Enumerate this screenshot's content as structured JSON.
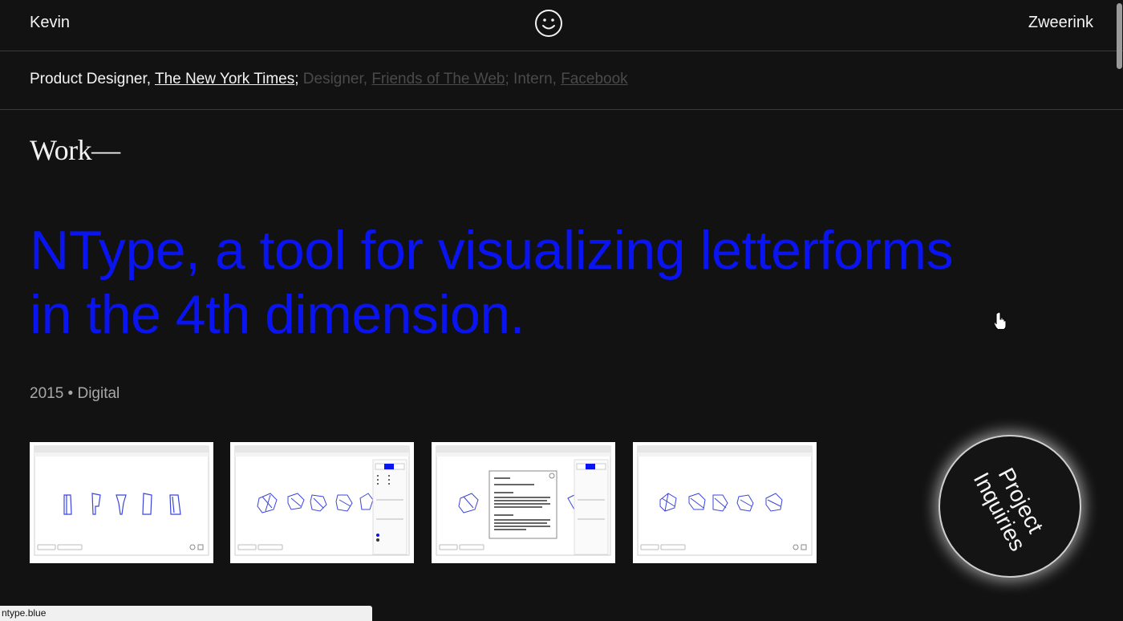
{
  "header": {
    "first_name": "Kevin",
    "last_name": "Zweerink",
    "logo_icon": "smiley-face-icon"
  },
  "roles": {
    "current_title": "Product Designer, ",
    "current_employer": "The New York Times",
    "current_sep": ";",
    "past_1_title": " Designer, ",
    "past_1_employer": "Friends of The Web",
    "past_1_sep": ";",
    "past_2_title": " Intern, ",
    "past_2_employer": "Facebook"
  },
  "work": {
    "heading": "Work—",
    "project": {
      "title": "NType, a tool for visualizing letterforms in the 4th dimension.",
      "meta": "2015 • Digital",
      "title_color": "#0a14f0"
    }
  },
  "inquiries": {
    "line1": "Project",
    "line2": "Inquiries"
  },
  "status_bar": {
    "url": "ntype.blue"
  },
  "colors": {
    "background": "#121212",
    "accent": "#0a14f0",
    "text": "#f2f2f2",
    "muted": "#4a4a4a"
  }
}
